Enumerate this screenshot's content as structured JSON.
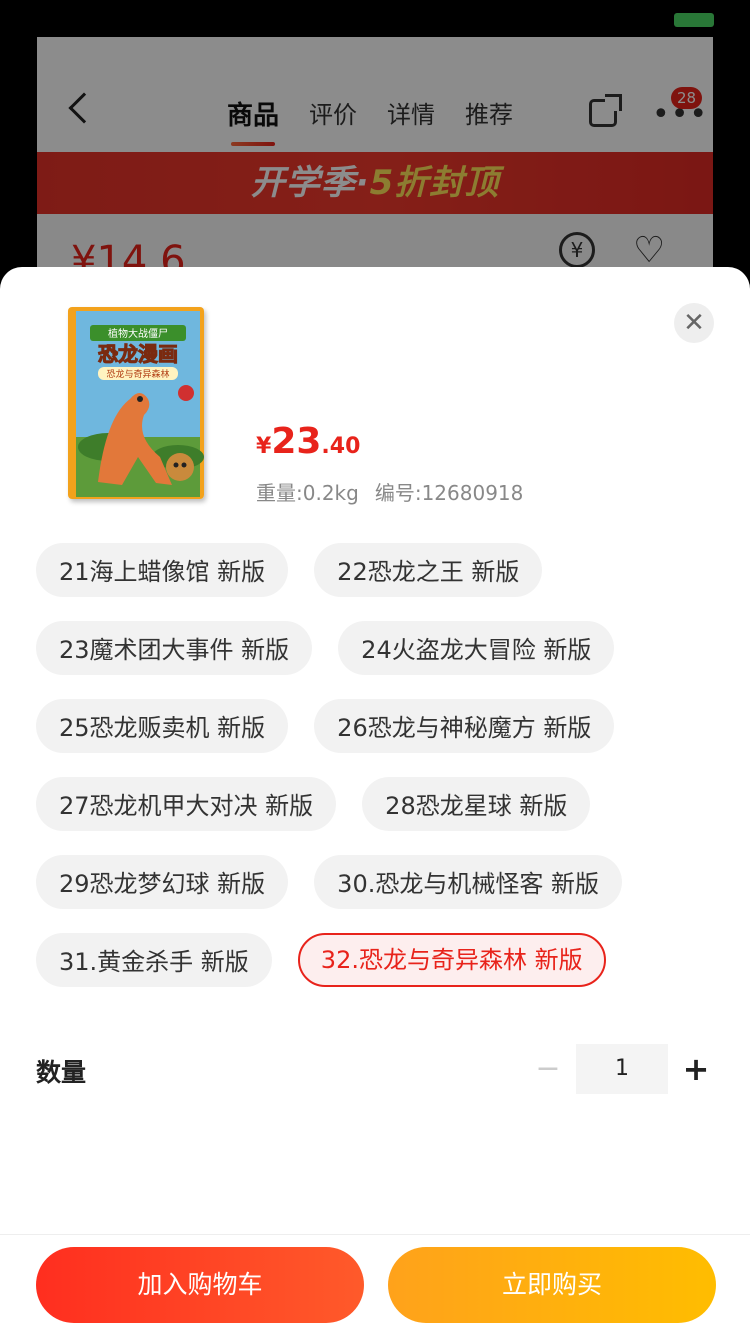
{
  "background": {
    "tabs": [
      "商品",
      "评价",
      "详情",
      "推荐"
    ],
    "more_badge": "28",
    "banner": {
      "text_left": "开学季·",
      "text_highlight": "5折封顶"
    },
    "price_partial": "¥14.6"
  },
  "sheet": {
    "close_symbol": "✕",
    "cover": {
      "series": "植物大战僵尸",
      "title": "恐龙漫画",
      "subtitle": "恐龙与奇异森林"
    },
    "price": {
      "yen": "¥",
      "integer": "23",
      "decimal": ".40"
    },
    "weight": "重量:0.2kg",
    "sku_no": "编号:12680918",
    "options": [
      {
        "label": "21海上蜡像馆 新版",
        "selected": false
      },
      {
        "label": "22恐龙之王 新版",
        "selected": false
      },
      {
        "label": "23魔术团大事件 新版",
        "selected": false
      },
      {
        "label": "24火盗龙大冒险 新版",
        "selected": false
      },
      {
        "label": "25恐龙贩卖机 新版",
        "selected": false
      },
      {
        "label": "26恐龙与神秘魔方 新版",
        "selected": false
      },
      {
        "label": "27恐龙机甲大对决 新版",
        "selected": false
      },
      {
        "label": "28恐龙星球 新版",
        "selected": false
      },
      {
        "label": "29恐龙梦幻球 新版",
        "selected": false
      },
      {
        "label": "30.恐龙与机械怪客 新版",
        "selected": false
      },
      {
        "label": "31.黄金杀手 新版",
        "selected": false
      },
      {
        "label": "32.恐龙与奇异森林 新版",
        "selected": true
      }
    ],
    "quantity": {
      "label": "数量",
      "minus": "−",
      "value": "1",
      "plus": "+"
    },
    "buttons": {
      "add_to_cart": "加入购物车",
      "buy_now": "立即购买"
    }
  },
  "colors": {
    "accent": "#e8231b",
    "buy": "#ffb300"
  }
}
